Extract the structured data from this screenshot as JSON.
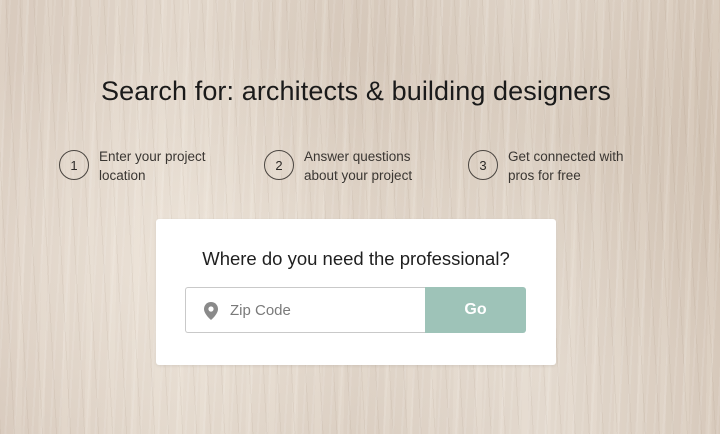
{
  "page": {
    "title": "Search for: architects & building designers"
  },
  "steps": [
    {
      "number": "1",
      "text": "Enter your project location"
    },
    {
      "number": "2",
      "text": "Answer questions about your project"
    },
    {
      "number": "3",
      "text": "Get connected with pros for free"
    }
  ],
  "search_card": {
    "question": "Where do you need the professional?",
    "zip_placeholder": "Zip Code",
    "zip_value": "",
    "go_label": "Go",
    "location_icon": "map-pin-icon"
  },
  "colors": {
    "go_button": "#9ec3b8",
    "card_background": "#ffffff",
    "text": "#1a1a1a"
  }
}
